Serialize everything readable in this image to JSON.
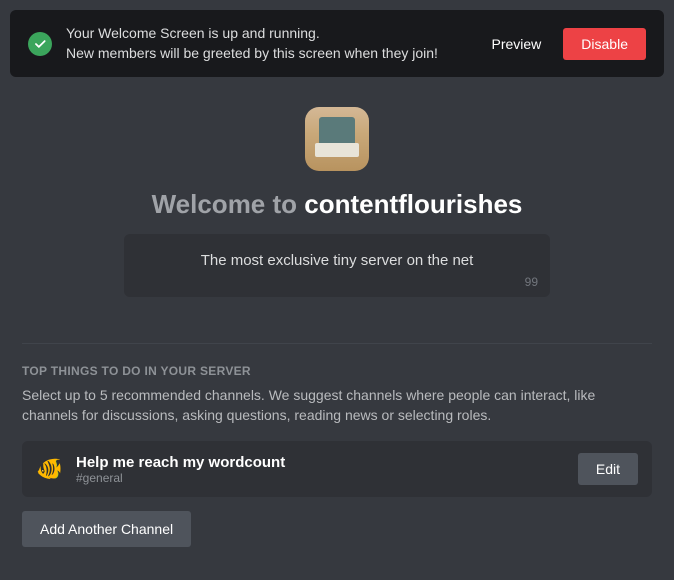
{
  "banner": {
    "line1": "Your Welcome Screen is up and running.",
    "line2": "New members will be greeted by this screen when they join!",
    "preview_label": "Preview",
    "disable_label": "Disable"
  },
  "welcome": {
    "prefix": "Welcome to ",
    "server_name": "contentflourishes",
    "description": "The most exclusive tiny server on the net",
    "char_remaining": "99"
  },
  "section": {
    "heading": "TOP THINGS TO DO IN YOUR SERVER",
    "description": "Select up to 5 recommended channels. We suggest channels where people can interact, like channels for discussions, asking questions, reading news or selecting roles."
  },
  "channels": [
    {
      "emoji": "🐠",
      "title": "Help me reach my wordcount",
      "name": "#general",
      "edit_label": "Edit"
    }
  ],
  "add_button_label": "Add Another Channel"
}
